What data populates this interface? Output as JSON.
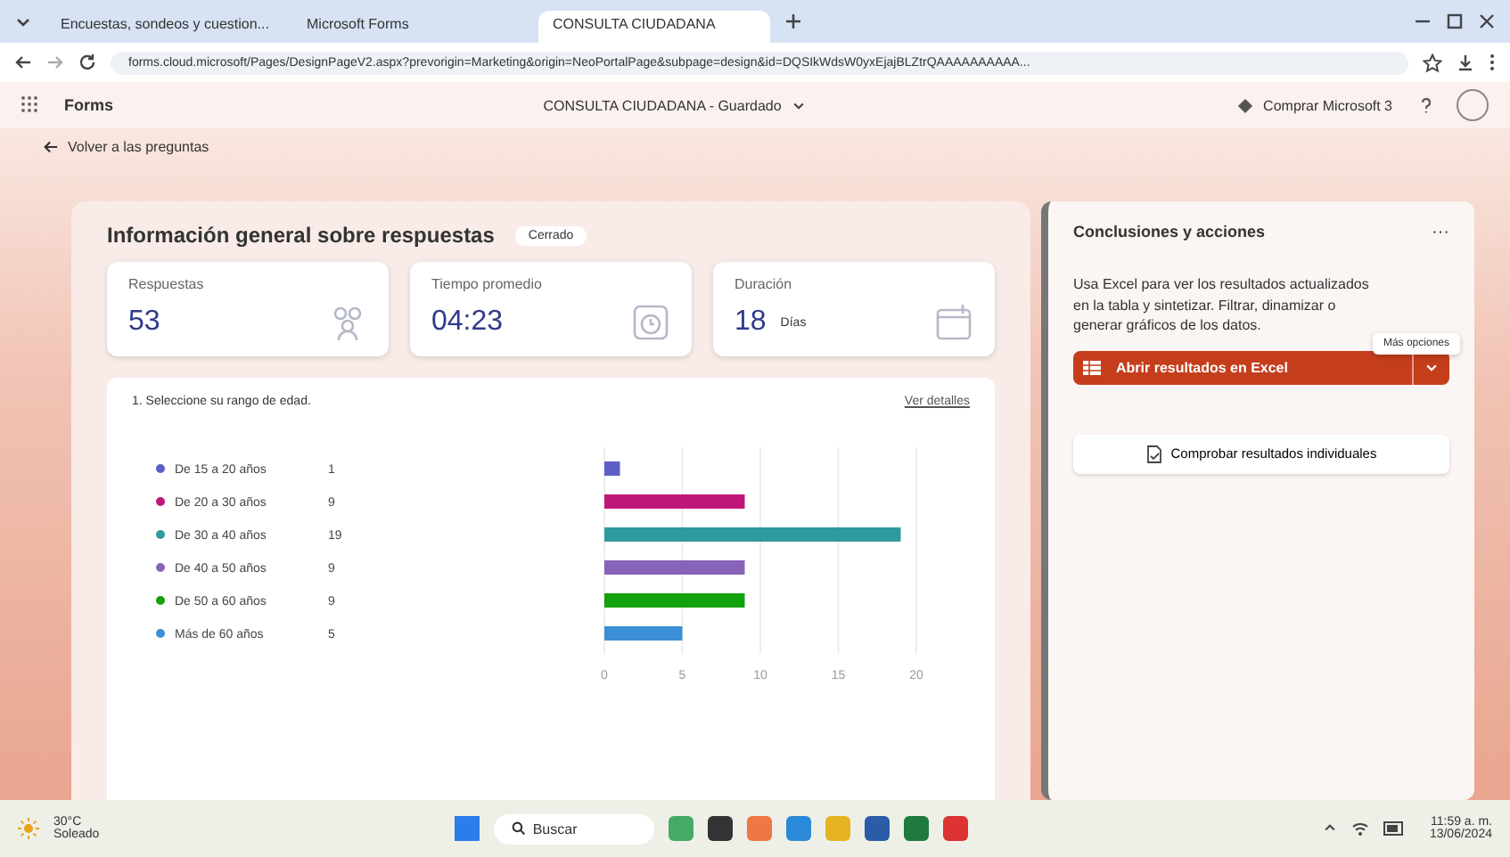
{
  "browser": {
    "tabs": [
      {
        "title": "Encuestas, sondeos y cuestion...",
        "selected": false
      },
      {
        "title": "Microsoft Forms",
        "selected": false
      },
      {
        "title": "CONSULTA CIUDADANA",
        "selected": true
      }
    ],
    "url": "forms.cloud.microsoft/Pages/DesignPageV2.aspx?prevorigin=Marketing&origin=NeoPortalPage&subpage=design&id=DQSIkWdsW0yxEjajBLZtrQAAAAAAAAAA..."
  },
  "app": {
    "name": "Forms",
    "form_title": "CONSULTA CIUDADANA",
    "separator": "-",
    "save_state": "Guardado",
    "buy": "Comprar Microsoft 3"
  },
  "back_link": "Volver a las preguntas",
  "overview": {
    "title": "Información general sobre respuestas",
    "status": "Cerrado",
    "stats": [
      {
        "label": "Respuestas",
        "value": "53",
        "kind": "people"
      },
      {
        "label": "Tiempo promedio",
        "value": "04:23",
        "kind": "clock"
      },
      {
        "label": "Duración",
        "value": "18",
        "unit": "Días",
        "kind": "calendar"
      }
    ]
  },
  "question": {
    "title": "1. Seleccione su rango de edad.",
    "details_link": "Ver detalles",
    "options": [
      {
        "label": "De 15 a 20 años",
        "count": "1",
        "color": "#5b5fc7"
      },
      {
        "label": "De 20 a 30 años",
        "count": "9",
        "color": "#c0157a"
      },
      {
        "label": "De 30 a 40 años",
        "count": "19",
        "color": "#2f9aa0"
      },
      {
        "label": "De 40 a 50 años",
        "count": "9",
        "color": "#8764b8"
      },
      {
        "label": "De 50 a 60 años",
        "count": "9",
        "color": "#13a10e"
      },
      {
        "label": "Más de 60 años",
        "count": "5",
        "color": "#3a8fd6"
      }
    ],
    "chart_data": {
      "type": "bar",
      "orientation": "horizontal",
      "grid": true,
      "values": [
        1,
        9,
        19,
        9,
        9,
        5
      ],
      "xlim": [
        0,
        20
      ],
      "xticks": [
        0,
        5,
        10,
        15,
        20
      ]
    }
  },
  "insights": {
    "title": "Conclusiones y acciones",
    "more": "···",
    "text": "Usa Excel para ver los resultados actualizados en la tabla y sintetizar. Filtrar, dinamizar o generar gráficos de los datos.",
    "tooltip": "Más opciones",
    "excel_button": "Abrir resultados en Excel",
    "review_button": "Comprobar resultados individuales"
  },
  "taskbar": {
    "weather_temp": "30°C",
    "weather_text": "Soleado",
    "search": "Buscar",
    "time": "11:59 a. m.",
    "date": "13/06/2024"
  }
}
